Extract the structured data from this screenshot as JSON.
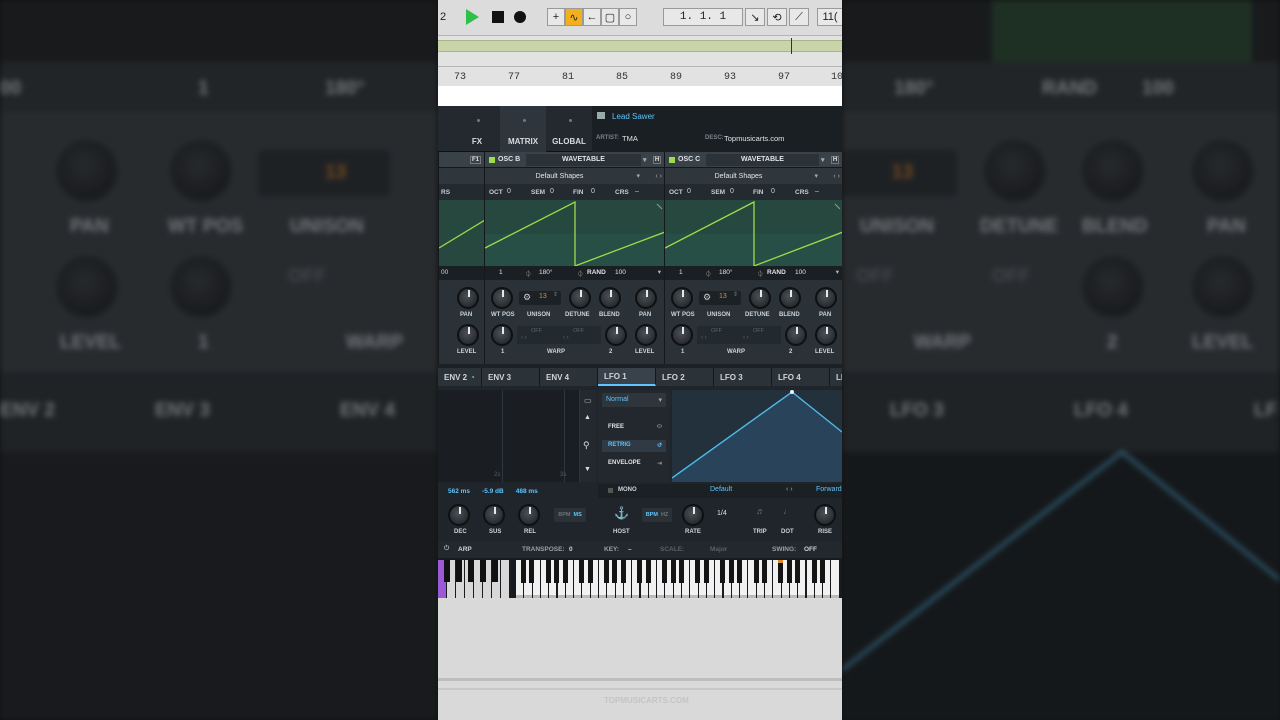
{
  "transport": {
    "left_number": "2",
    "position": "1.   1.   1",
    "tempo_partial": "11("
  },
  "ruler": {
    "bars": [
      "73",
      "77",
      "81",
      "85",
      "89",
      "93",
      "97",
      "10"
    ]
  },
  "serum": {
    "tabs": [
      "FX",
      "MATRIX",
      "GLOBAL"
    ],
    "preset": {
      "name": "Lead Sawer",
      "artist_label": "ARTIST:",
      "artist": "TMA",
      "desc_label": "DESC:",
      "desc": "Topmusicarts.com"
    },
    "osc_partial_tab": "F1",
    "oscillators": [
      {
        "name": "OSC B",
        "type": "WAVETABLE",
        "table": "Default Shapes",
        "oct_label": "OCT",
        "oct": "0",
        "sem_label": "SEM",
        "sem": "0",
        "fin_label": "FIN",
        "fin": "0",
        "crs_label": "CRS",
        "crs": "–",
        "wt_index": "1",
        "phase": "180°",
        "rand_label": "RAND",
        "rand": "100",
        "unison": "13",
        "knob_labels": [
          "WT POS",
          "UNISON",
          "DETUNE",
          "BLEND",
          "PAN",
          "LEVEL"
        ],
        "warp_label": "WARP",
        "warp_off": "OFF",
        "warp_num1": "1",
        "warp_num2": "2"
      },
      {
        "name": "OSC C",
        "type": "WAVETABLE",
        "table": "Default Shapes",
        "oct_label": "OCT",
        "oct": "0",
        "sem_label": "SEM",
        "sem": "0",
        "fin_label": "FIN",
        "fin": "0",
        "crs_label": "CRS",
        "crs": "–",
        "wt_index": "1",
        "phase": "180°",
        "rand_label": "RAND",
        "rand": "100",
        "unison": "13",
        "knob_labels": [
          "WT POS",
          "UNISON",
          "DETUNE",
          "BLEND",
          "PAN",
          "LEVEL"
        ],
        "warp_label": "WARP",
        "warp_off": "OFF",
        "warp_num1": "1",
        "warp_num2": "2"
      }
    ],
    "left_partial": {
      "crs": "RS",
      "value": "00",
      "pan": "PAN",
      "level": "LEVEL"
    },
    "mod_tabs": [
      "ENV 2",
      "ENV 3",
      "ENV 4",
      "LFO 1",
      "LFO 2",
      "LFO 3",
      "LFO 4",
      "LF"
    ],
    "env": {
      "values": [
        "562 ms",
        "-5.9 dB",
        "488 ms"
      ],
      "grid_labels": [
        "2s",
        "3s"
      ],
      "knobs": [
        "DEC",
        "SUS",
        "REL"
      ],
      "bpm": "BPM",
      "ms": "MS"
    },
    "lfo": {
      "mode": "Normal",
      "options": [
        "FREE",
        "RETRIG",
        "ENVELOPE"
      ],
      "mono": "MONO",
      "preset": "Default",
      "direction": "Forward",
      "bpm": "BPM",
      "hz": "HZ",
      "rate_value": "1/4",
      "knobs": [
        "HOST",
        "RATE",
        "TRIP",
        "DOT",
        "RISE"
      ]
    },
    "arp": {
      "label": "ARP",
      "transpose_label": "TRANSPOSE:",
      "transpose": "0",
      "key_label": "KEY:",
      "key": "–",
      "scale_label": "SCALE:",
      "scale": "Major",
      "swing_label": "SWING:",
      "swing": "OFF"
    }
  },
  "watermark": "TOPMUSICARTS.COM",
  "background": {
    "labels_left": [
      "00",
      "1",
      "180°",
      "PAN",
      "WT POS",
      "UNISON",
      "13",
      "OFF",
      "LEVEL",
      "1",
      "WARP",
      "ENV 2",
      "ENV 3",
      "ENV 4"
    ],
    "labels_right": [
      "180°",
      "RAND",
      "100",
      "DETUNE",
      "BLEND",
      "PAN",
      "UNISON",
      "13",
      "OFF",
      "OFF",
      "WARP",
      "2",
      "LEVEL",
      "LFO 3",
      "LFO 4",
      "LF"
    ]
  },
  "colors": {
    "accent_green": "#9ddc4a",
    "accent_blue": "#4fb8e8",
    "arp_purple": "#9b59d6"
  }
}
